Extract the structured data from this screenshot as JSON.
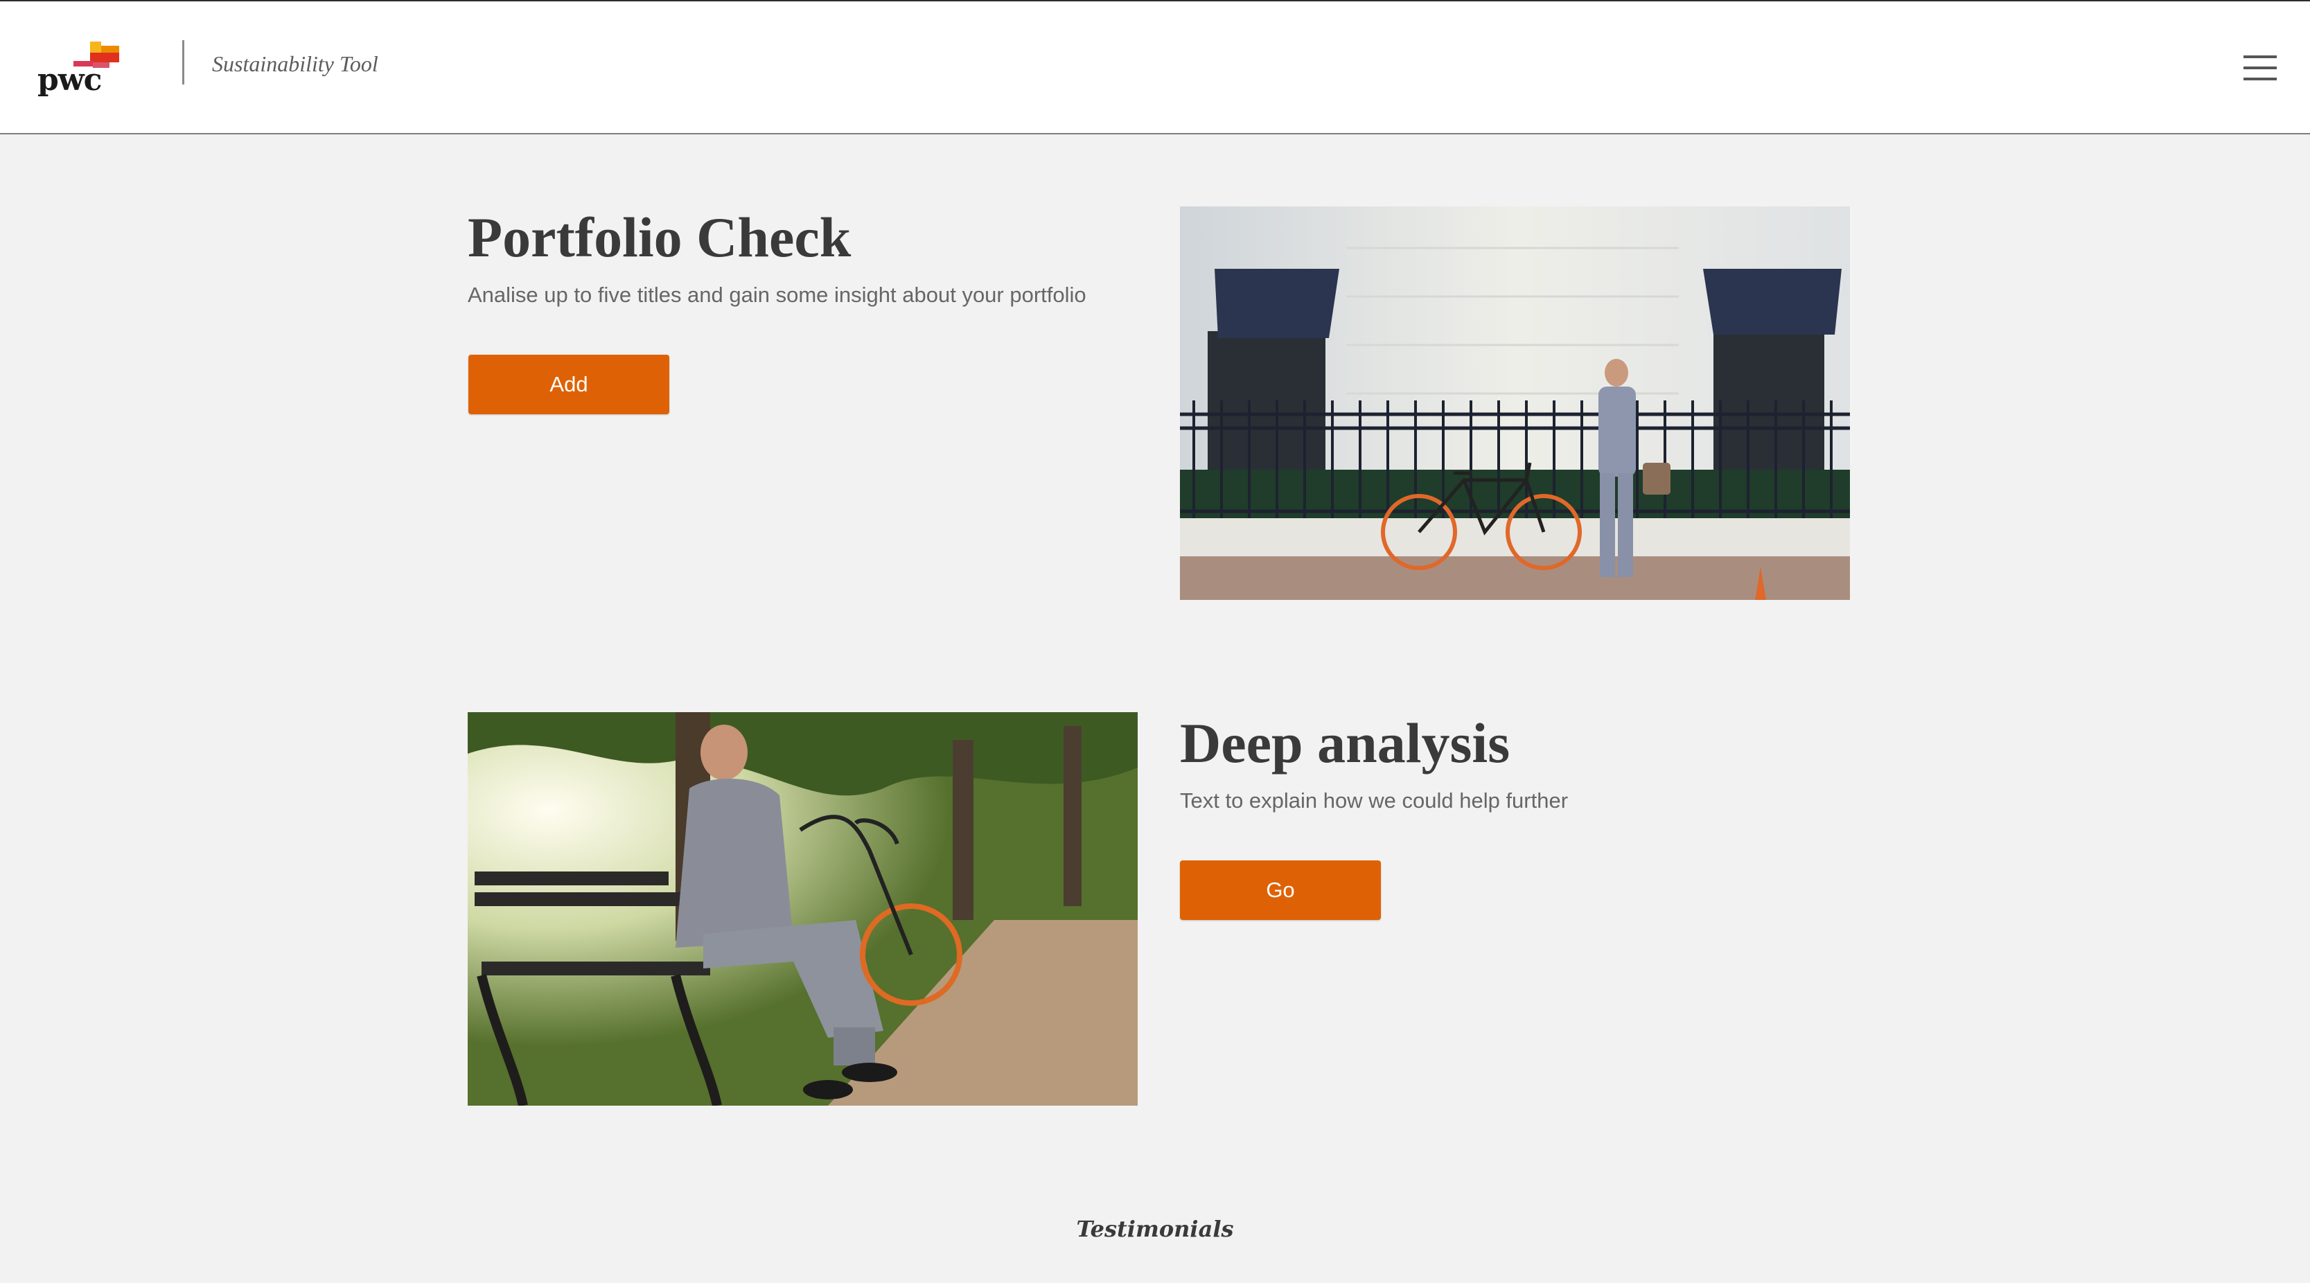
{
  "header": {
    "logo_text": "pwc",
    "app_name": "Sustainability Tool",
    "menu_icon": "hamburger-menu-icon"
  },
  "portfolio": {
    "title": "Portfolio Check",
    "description": "Analise up to five titles and gain some insight about your portfolio",
    "button_label": "Add",
    "image": "photo-businessman-standing-with-bicycle"
  },
  "analysis": {
    "title": "Deep analysis",
    "description": "Text to explain how we could help further",
    "button_label": "Go",
    "image": "photo-businessman-on-park-bench"
  },
  "testimonials": {
    "heading": "Testimonials"
  },
  "colors": {
    "accent": "#de6205",
    "background": "#f2f2f2",
    "header_bg": "#ffffff",
    "title_text": "#3a3a3a",
    "body_text": "#666666"
  }
}
